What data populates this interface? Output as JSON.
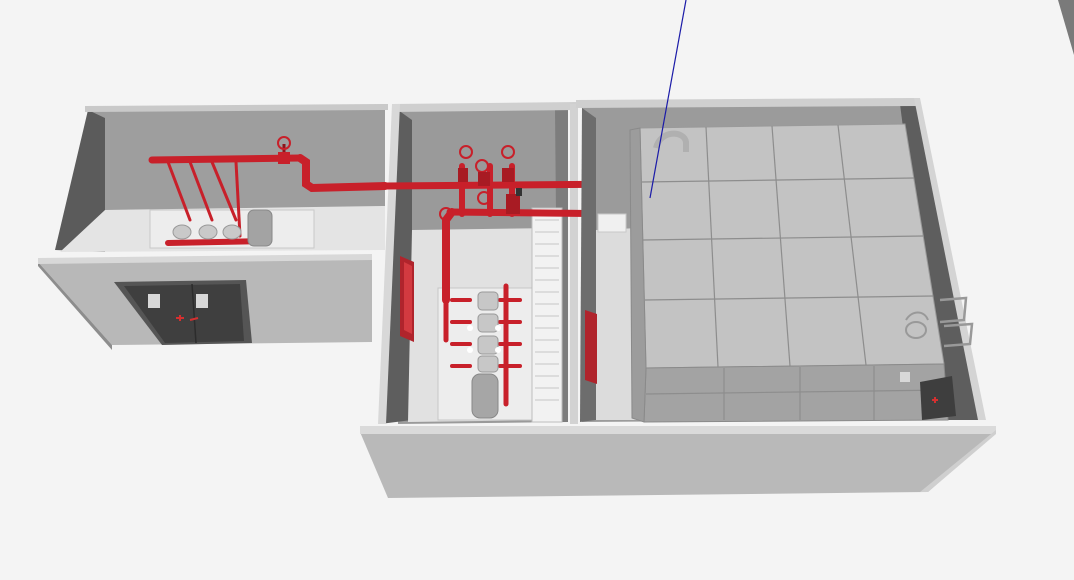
{
  "scene": {
    "background": "#f4f4f4",
    "wall_light": "#a9a9a9",
    "wall_mid": "#8c8c8c",
    "wall_dark": "#5e5e5e",
    "floor": "#e6e6e6",
    "pipe": "#c8202a",
    "pipe_dark": "#8e141b",
    "tank": "#b7b7b7",
    "tank_line": "#8a8a8a",
    "pointer": "#1a1aa8"
  },
  "objects": {
    "left_room": "valve-room-small",
    "pump_room": "fire-pump-room",
    "tank_room": "water-tank-room",
    "door": "double-door-icon",
    "pointer": "axis-line"
  }
}
